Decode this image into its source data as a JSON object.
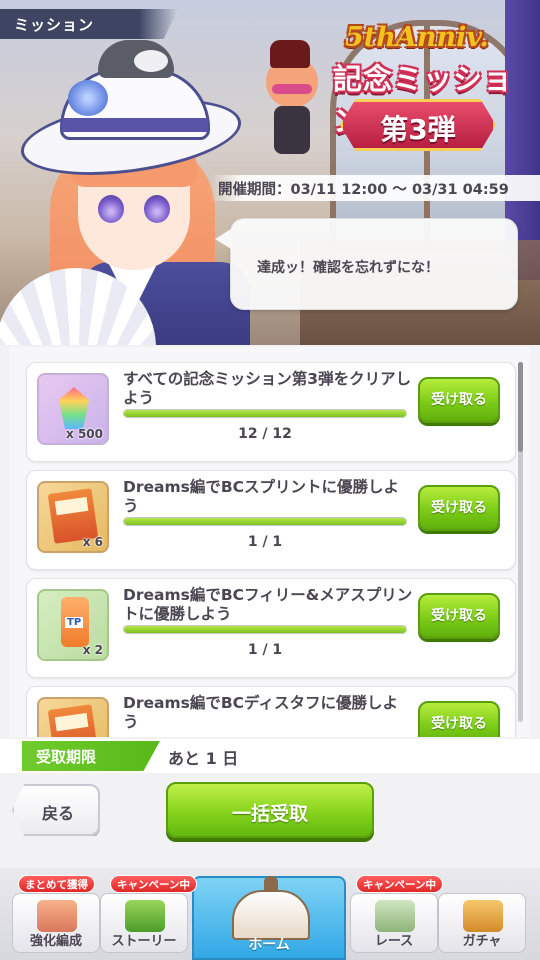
{
  "screen": {
    "title": "ミッション"
  },
  "banner": {
    "logo_anniv": "5thAnniv.",
    "logo_main": "記念ミッション",
    "logo_sub": "第3弾",
    "period": "開催期間：03/11 12:00 ～ 03/31 04:59",
    "speech": "達成ッ！確認を忘れずにな！"
  },
  "missions": [
    {
      "title": "すべての記念ミッション第3弾をクリアしよう",
      "reward_qty": "x 500",
      "reward_icon": "rainbow-gem-icon",
      "progress": "12 / 12",
      "progress_ratio": 1.0,
      "claim_label": "受け取る"
    },
    {
      "title": "Dreams編でBCスプリントに優勝しよう",
      "reward_qty": "x 6",
      "reward_icon": "item-book-icon",
      "progress": "1 / 1",
      "progress_ratio": 1.0,
      "claim_label": "受け取る"
    },
    {
      "title": "Dreams編でBCフィリー&メアスプリントに優勝しよう",
      "reward_qty": "x 2",
      "reward_icon": "tp-bottle-icon",
      "progress": "1 / 1",
      "progress_ratio": 1.0,
      "claim_label": "受け取る"
    },
    {
      "title": "Dreams編でBCディスタフに優勝しよう",
      "reward_qty": "",
      "reward_icon": "item-book-icon",
      "progress": "",
      "progress_ratio": 1.0,
      "claim_label": "受け取る"
    }
  ],
  "deadline": {
    "label": "受取期限",
    "value": "あと 1 日"
  },
  "buttons": {
    "back": "戻る",
    "bulk_claim": "一括受取"
  },
  "nav": {
    "items": [
      {
        "label": "強化編成",
        "badge": "まとめて獲得"
      },
      {
        "label": "ストーリー",
        "badge": "キャンペーン中"
      },
      {
        "label": "ホーム",
        "badge": ""
      },
      {
        "label": "レース",
        "badge": "キャンペーン中"
      },
      {
        "label": "ガチャ",
        "badge": ""
      }
    ]
  },
  "colors": {
    "accent_green": "#7cc21c",
    "home_blue": "#31a8e6",
    "text": "#4a4652",
    "badge_red": "#e02828"
  }
}
